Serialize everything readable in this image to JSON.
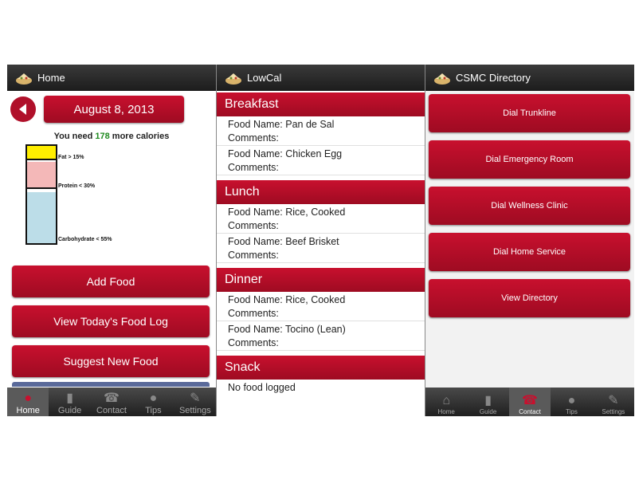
{
  "home": {
    "title": "Home",
    "date": "August 8, 2013",
    "need_prefix": "You need ",
    "need_value": "178",
    "need_suffix": " more calories",
    "bar_labels": [
      "Fat > 15%",
      "Protein < 30%",
      "Carbohydrate < 55%"
    ],
    "buttons": [
      "Add Food",
      "View Today's Food Log",
      "Suggest New Food"
    ],
    "tabs": [
      "Home",
      "Guide",
      "Contact",
      "Tips",
      "Settings"
    ]
  },
  "lowcal": {
    "title": "LowCal",
    "meals": [
      {
        "name": "Breakfast",
        "entries": [
          {
            "food": "Food Name: Pan de Sal",
            "comments": "Comments:"
          },
          {
            "food": "Food Name: Chicken Egg",
            "comments": "Comments:"
          }
        ]
      },
      {
        "name": "Lunch",
        "entries": [
          {
            "food": "Food Name: Rice, Cooked",
            "comments": "Comments:"
          },
          {
            "food": "Food Name: Beef Brisket",
            "comments": "Comments:"
          }
        ]
      },
      {
        "name": "Dinner",
        "entries": [
          {
            "food": "Food Name: Rice, Cooked",
            "comments": "Comments:"
          },
          {
            "food": "Food Name: Tocino (Lean)",
            "comments": "Comments:"
          }
        ]
      },
      {
        "name": "Snack",
        "empty": "No food logged"
      }
    ]
  },
  "directory": {
    "title": "CSMC Directory",
    "buttons": [
      "Dial Trunkline",
      "Dial Emergency Room",
      "Dial Wellness Clinic",
      "Dial Home Service",
      "View Directory"
    ],
    "tabs": [
      "Home",
      "Guide",
      "Contact",
      "Tips",
      "Settings"
    ]
  },
  "colors": {
    "accent": "#c8102e",
    "calories": "#1f8a1f",
    "fat": "#ffee00",
    "protein": "#f4b8b8",
    "carbohydrate": "#bcdde8"
  },
  "nutrient_levels": {
    "fat": 0.12,
    "protein": 0.28,
    "carbohydrate": 0.55
  }
}
